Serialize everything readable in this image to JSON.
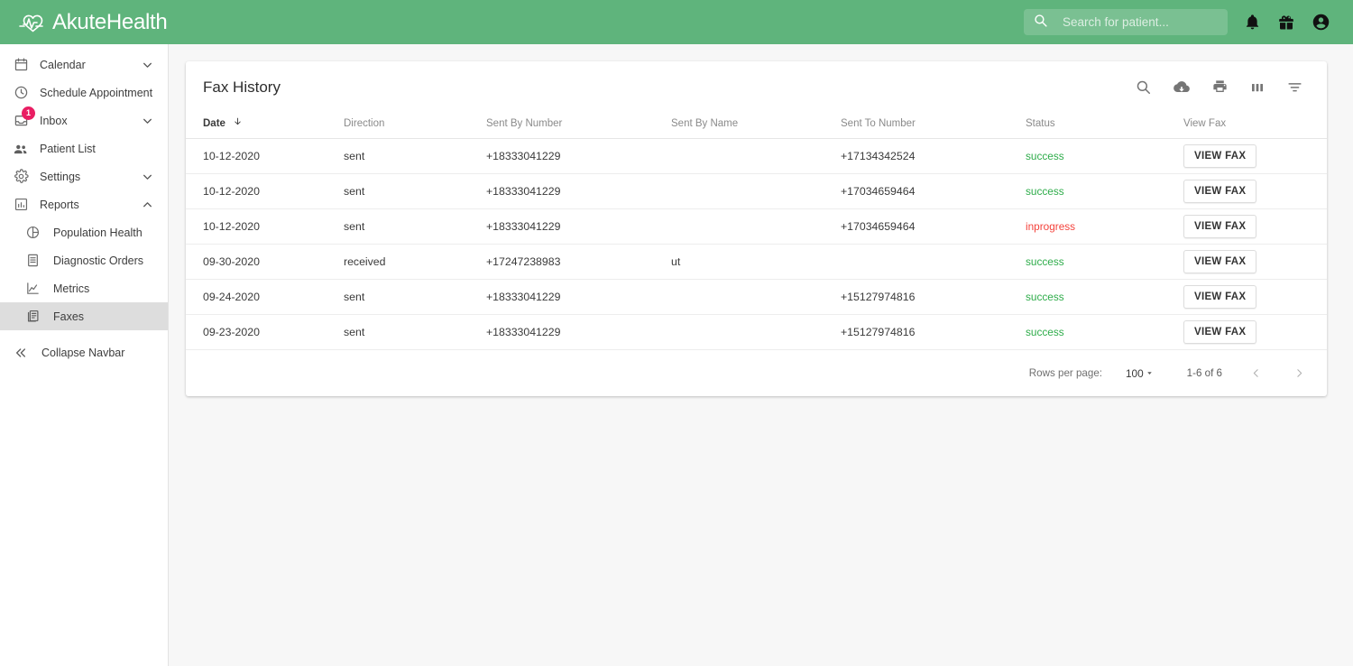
{
  "app": {
    "brand": "AkuteHealth",
    "brand_color": "#5fb47c",
    "logo_icon": "heart-pulse-icon"
  },
  "header": {
    "search_placeholder": "Search for patient...",
    "search_value": "",
    "icons": [
      "search-icon",
      "notifications-bell-icon",
      "gift-icon",
      "account-circle-icon"
    ]
  },
  "sidebar": {
    "items": [
      {
        "label": "Calendar",
        "icon": "calendar-icon",
        "expandable": true,
        "expanded": false,
        "active": false,
        "sub": false
      },
      {
        "label": "Schedule Appointment",
        "icon": "clock-icon",
        "expandable": false,
        "expanded": false,
        "active": false,
        "sub": false
      },
      {
        "label": "Inbox",
        "icon": "inbox-icon",
        "expandable": true,
        "expanded": false,
        "active": false,
        "sub": false,
        "badge": "1"
      },
      {
        "label": "Patient List",
        "icon": "people-icon",
        "expandable": false,
        "expanded": false,
        "active": false,
        "sub": false
      },
      {
        "label": "Settings",
        "icon": "gear-icon",
        "expandable": true,
        "expanded": false,
        "active": false,
        "sub": false
      },
      {
        "label": "Reports",
        "icon": "bar-chart-icon",
        "expandable": true,
        "expanded": true,
        "active": false,
        "sub": false
      },
      {
        "label": "Population Health",
        "icon": "pie-chart-icon",
        "expandable": false,
        "expanded": false,
        "active": false,
        "sub": true
      },
      {
        "label": "Diagnostic Orders",
        "icon": "document-list-icon",
        "expandable": false,
        "expanded": false,
        "active": false,
        "sub": true
      },
      {
        "label": "Metrics",
        "icon": "line-chart-icon",
        "expandable": false,
        "expanded": false,
        "active": false,
        "sub": true
      },
      {
        "label": "Faxes",
        "icon": "fax-pages-icon",
        "expandable": false,
        "expanded": false,
        "active": true,
        "sub": true
      }
    ],
    "collapse": {
      "label": "Collapse Navbar",
      "icon": "double-chevron-left-icon"
    },
    "badge_color": "#e91e63",
    "active_bg": "#dddddd"
  },
  "card": {
    "title": "Fax History",
    "toolbar": [
      {
        "name": "search-icon",
        "label": "Search"
      },
      {
        "name": "cloud-download-icon",
        "label": "Download"
      },
      {
        "name": "print-icon",
        "label": "Print"
      },
      {
        "name": "columns-icon",
        "label": "Columns"
      },
      {
        "name": "filter-icon",
        "label": "Filter"
      }
    ]
  },
  "table": {
    "columns": [
      {
        "key": "date",
        "label": "Date",
        "sorted": true,
        "sort_dir": "desc"
      },
      {
        "key": "direction",
        "label": "Direction",
        "sorted": false
      },
      {
        "key": "sent_by_number",
        "label": "Sent By Number",
        "sorted": false
      },
      {
        "key": "sent_by_name",
        "label": "Sent By Name",
        "sorted": false
      },
      {
        "key": "sent_to_number",
        "label": "Sent To Number",
        "sorted": false
      },
      {
        "key": "status",
        "label": "Status",
        "sorted": false
      },
      {
        "key": "view_fax",
        "label": "View Fax",
        "sorted": false
      }
    ],
    "rows": [
      {
        "date": "10-12-2020",
        "direction": "sent",
        "sent_by_number": "+18333041229",
        "sent_by_name": "",
        "sent_to_number": "+17134342524",
        "status": "success",
        "view_fax": "VIEW FAX"
      },
      {
        "date": "10-12-2020",
        "direction": "sent",
        "sent_by_number": "+18333041229",
        "sent_by_name": "",
        "sent_to_number": "+17034659464",
        "status": "success",
        "view_fax": "VIEW FAX"
      },
      {
        "date": "10-12-2020",
        "direction": "sent",
        "sent_by_number": "+18333041229",
        "sent_by_name": "",
        "sent_to_number": "+17034659464",
        "status": "inprogress",
        "view_fax": "VIEW FAX"
      },
      {
        "date": "09-30-2020",
        "direction": "received",
        "sent_by_number": "+17247238983",
        "sent_by_name": "ut",
        "sent_to_number": "",
        "status": "success",
        "view_fax": "VIEW FAX"
      },
      {
        "date": "09-24-2020",
        "direction": "sent",
        "sent_by_number": "+18333041229",
        "sent_by_name": "",
        "sent_to_number": "+15127974816",
        "status": "success",
        "view_fax": "VIEW FAX"
      },
      {
        "date": "09-23-2020",
        "direction": "sent",
        "sent_by_number": "+18333041229",
        "sent_by_name": "",
        "sent_to_number": "+15127974816",
        "status": "success",
        "view_fax": "VIEW FAX"
      }
    ],
    "status_colors": {
      "success": "#2eac4a",
      "inprogress": "#f4433c"
    }
  },
  "pagination": {
    "rows_per_page_label": "Rows per page:",
    "rows_per_page_value": "100",
    "range_label": "1-6 of 6",
    "prev_icon": "chevron-left-icon",
    "next_icon": "chevron-right-icon"
  }
}
